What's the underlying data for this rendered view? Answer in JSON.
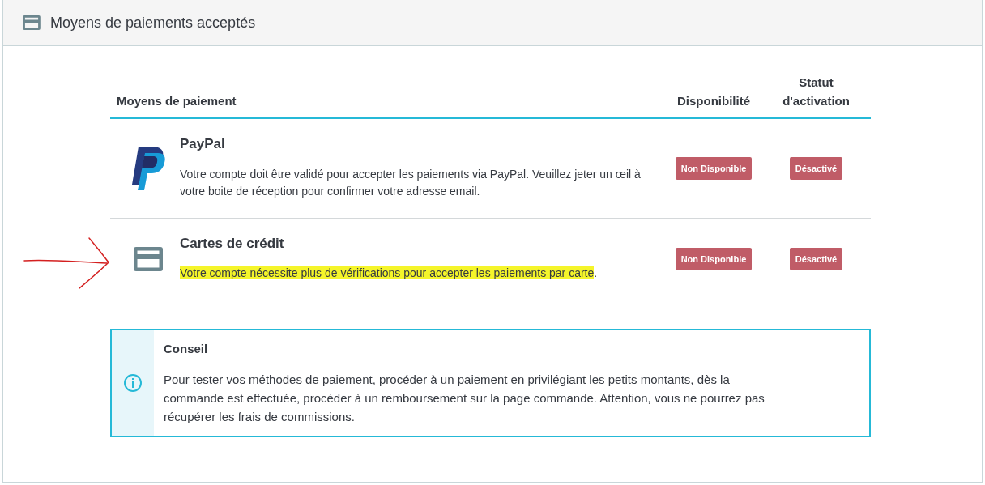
{
  "panel": {
    "title": "Moyens de paiements acceptés"
  },
  "table": {
    "columns": [
      "Moyens de paiement",
      "Disponibilité",
      "Statut d'activation"
    ],
    "rows": [
      {
        "kind": "paypal",
        "name": "PayPal",
        "description": "Votre compte doit être validé pour accepter les paiements via PayPal. Veuillez jeter un œil à votre boite de réception pour confirmer votre adresse email.",
        "highlighted": false,
        "arrow": false,
        "availability": "Non Disponible",
        "status": "Désactivé"
      },
      {
        "kind": "card",
        "name": "Cartes de crédit",
        "description": "Votre compte nécessite plus de vérifications pour accepter les paiements par carte",
        "suffix": ".",
        "highlighted": true,
        "arrow": true,
        "availability": "Non Disponible",
        "status": "Désactivé"
      }
    ]
  },
  "tip": {
    "title": "Conseil",
    "text": "Pour tester vos méthodes de paiement, procéder à un paiement en privilégiant les petits montants, dès la commande est effectuée, procéder à un remboursement sur la page commande. Attention, vous ne pourrez pas récupérer les frais de commissions."
  }
}
